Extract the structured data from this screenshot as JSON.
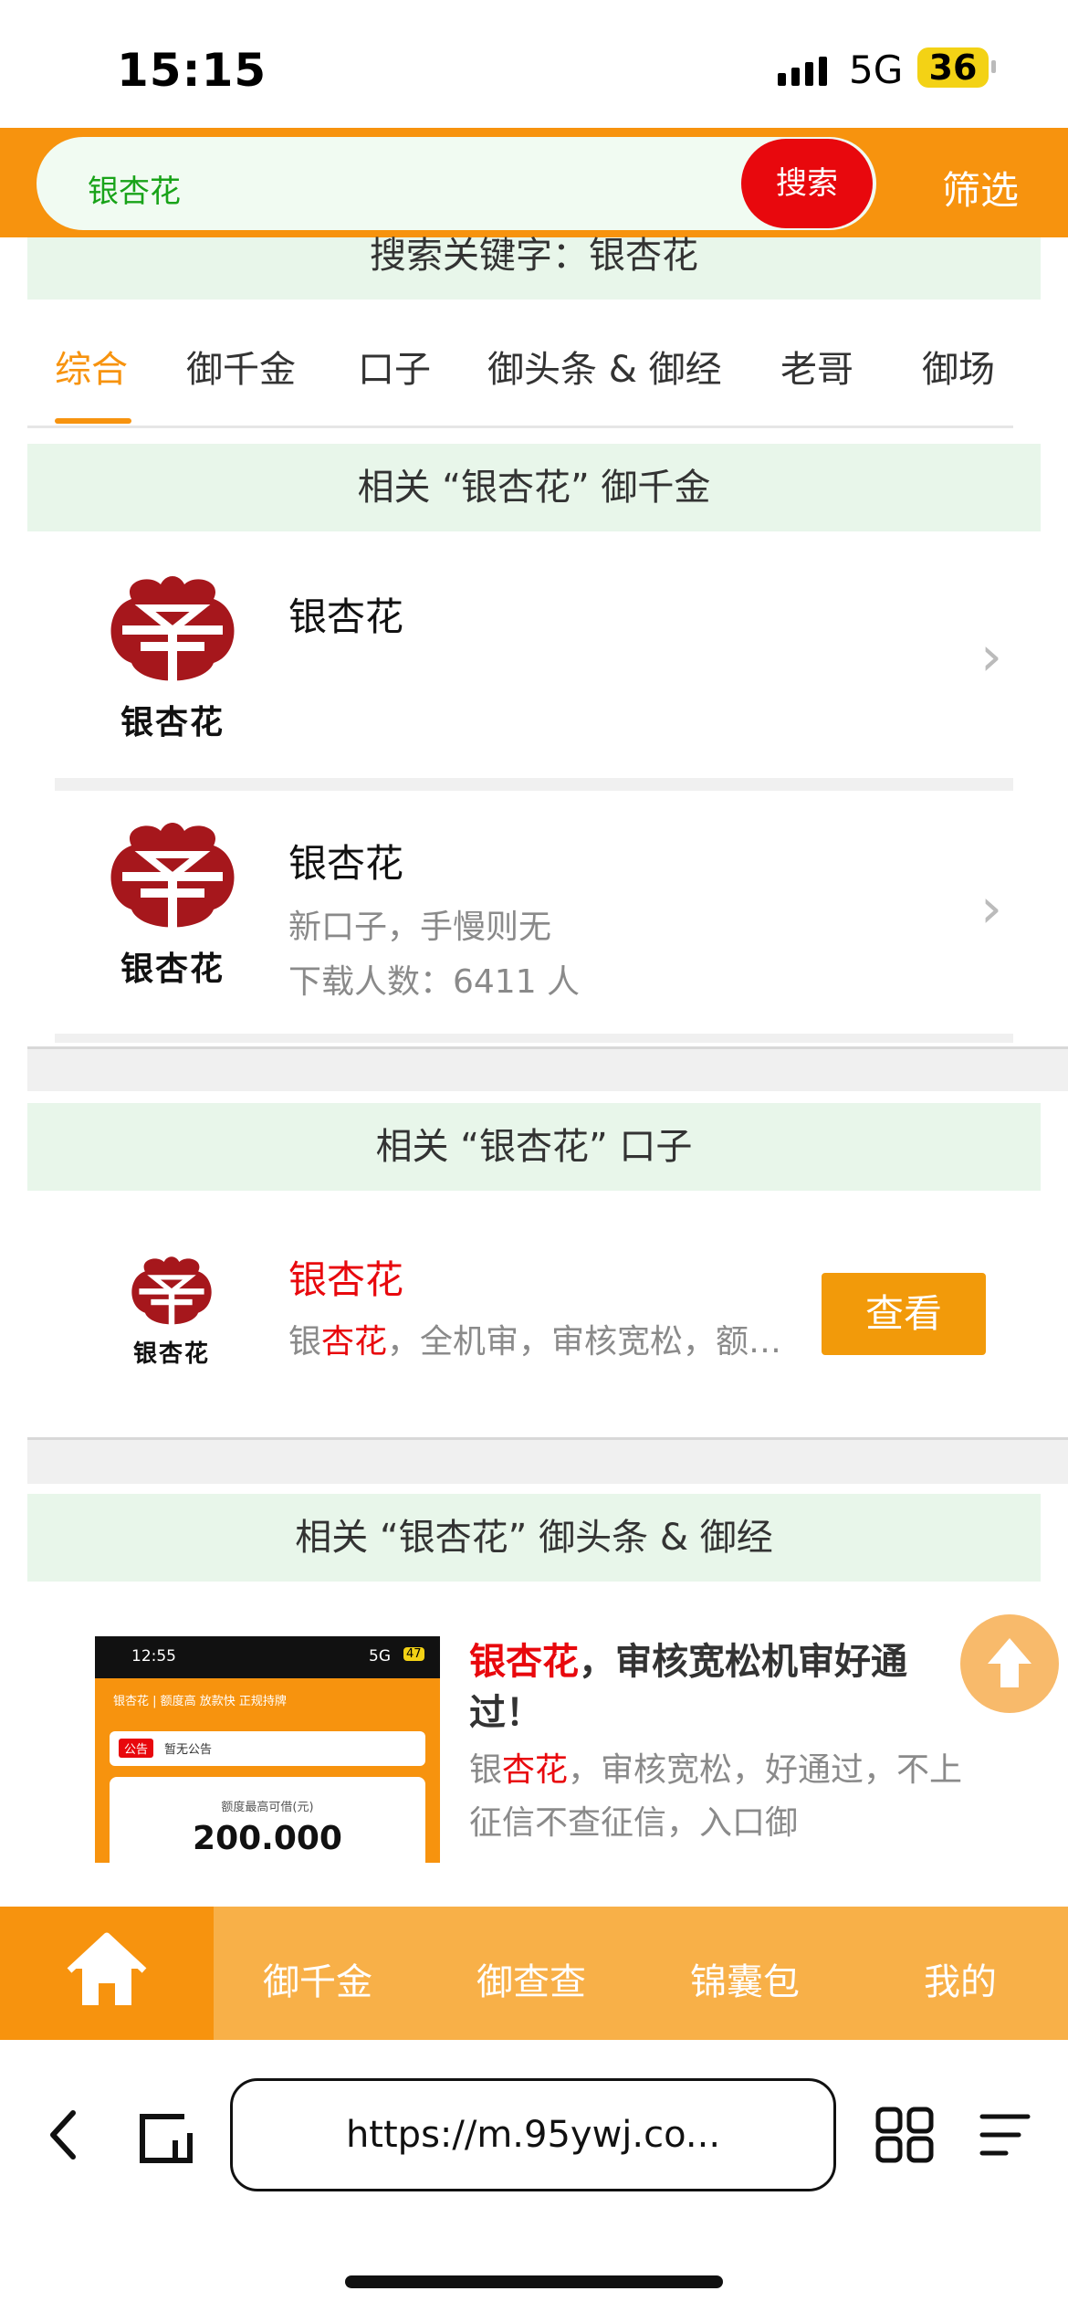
{
  "status": {
    "time": "15:15",
    "network": "5G",
    "battery": "36"
  },
  "header": {
    "search_value": "银杏花",
    "search_button": "搜索",
    "filter": "筛选"
  },
  "keyword_bar": "搜索关键字：银杏花",
  "tabs": [
    {
      "label": "综合",
      "active": true
    },
    {
      "label": "御千金",
      "active": false
    },
    {
      "label": "口子",
      "active": false
    },
    {
      "label": "御头条 & 御经",
      "active": false
    },
    {
      "label": "老哥",
      "active": false
    },
    {
      "label": "御场",
      "active": false
    }
  ],
  "section_yuqianjin": {
    "title": "相关 “银杏花” 御千金",
    "items": [
      {
        "logo_text": "银杏花",
        "title": "银杏花"
      },
      {
        "logo_text": "银杏花",
        "title": "银杏花",
        "subtitle": "新口子，手慢则无",
        "downloads": "下载人数：6411 人"
      }
    ]
  },
  "section_kouzi": {
    "title": "相关 “银杏花” 口子",
    "item": {
      "logo_text": "银杏花",
      "title": "银杏花",
      "desc_prefix": "银",
      "desc_highlight": "杏花",
      "desc_rest": "，全机审，审核宽松，额…",
      "button": "查看"
    }
  },
  "section_news": {
    "title": "相关 “银杏花” 御头条 & 御经",
    "item": {
      "title_highlight": "银杏花",
      "title_rest": "，审核宽松机审好通过！",
      "desc_prefix": "银",
      "desc_highlight": "杏花",
      "desc_rest": "，审核宽松，好通过，不上征信不查征信，入口御",
      "thumbnail": {
        "time": "12:55",
        "net": "5G",
        "batt": "47",
        "banner": "银杏花 | 额度高 放款快 正规持牌",
        "notice_tag": "公告",
        "notice_text": "暂无公告",
        "limit_label": "额度最高可借(元)",
        "limit_value": "200.000"
      }
    }
  },
  "bottom_nav": [
    {
      "label": "",
      "icon": "home-icon"
    },
    {
      "label": "御千金"
    },
    {
      "label": "御查查"
    },
    {
      "label": "锦囊包"
    },
    {
      "label": "我的"
    }
  ],
  "browser": {
    "url": "https://m.95ywj.co..."
  },
  "colors": {
    "accent": "#f7930e",
    "search_button": "#e8080d",
    "section_bg": "#e8f6ea",
    "highlight": "#e8080d"
  }
}
